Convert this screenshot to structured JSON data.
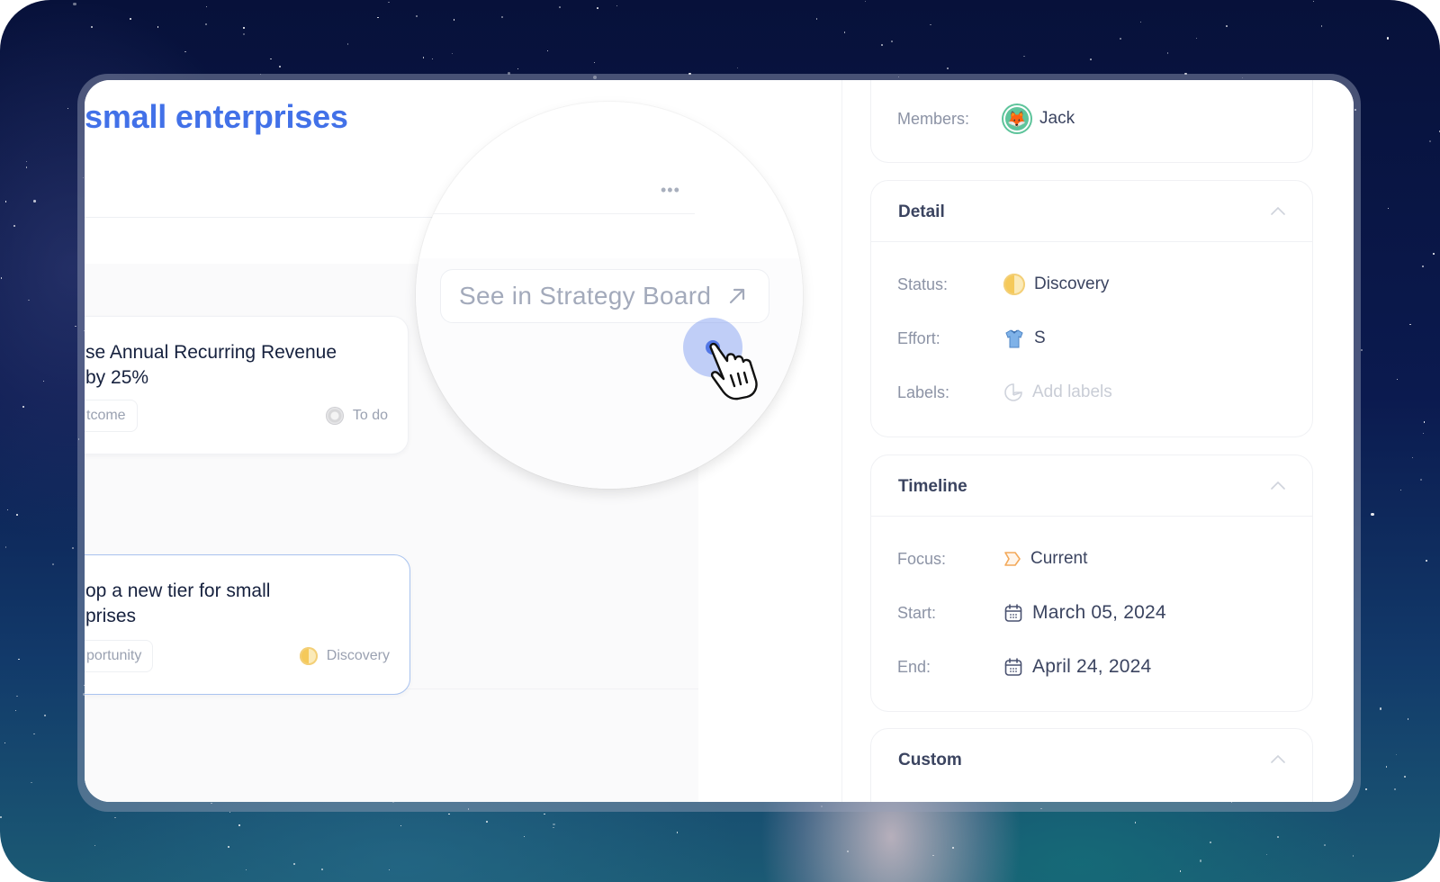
{
  "main": {
    "title": "small enterprises",
    "more_menu_glyph": "•••",
    "strategy_button": {
      "label": "See in Strategy Board",
      "icon": "arrow-up-right-icon"
    },
    "cards": [
      {
        "title_lines": [
          "se Annual Recurring Revenue",
          "by 25%"
        ],
        "tag": "tcome",
        "status": "To do",
        "status_icon": "todo-circle-icon",
        "selected": false
      },
      {
        "title_lines": [
          "op a new tier for small",
          "prises"
        ],
        "tag": "portunity",
        "status": "Discovery",
        "status_icon": "half-moon-icon",
        "selected": true
      }
    ]
  },
  "side_panel": {
    "members": {
      "label": "Members:",
      "value": "Jack",
      "avatar_emoji": "🦊"
    },
    "detail": {
      "title": "Detail",
      "expanded": true,
      "fields": {
        "status": {
          "label": "Status:",
          "value": "Discovery",
          "icon": "half-moon-icon"
        },
        "effort": {
          "label": "Effort:",
          "value": "S",
          "icon": "shirt-icon"
        },
        "labels": {
          "label": "Labels:",
          "value": "Add labels",
          "icon": "label-tag-icon"
        }
      }
    },
    "timeline": {
      "title": "Timeline",
      "expanded": true,
      "fields": {
        "focus": {
          "label": "Focus:",
          "value": "Current",
          "icon": "focus-chevron-icon"
        },
        "start": {
          "label": "Start:",
          "value": "March 05, 2024",
          "icon": "calendar-icon"
        },
        "end": {
          "label": "End:",
          "value": "April 24, 2024",
          "icon": "calendar-icon"
        }
      }
    },
    "custom": {
      "title": "Custom",
      "expanded": true
    }
  },
  "colors": {
    "accent": "#4271e8",
    "selected_card_border": "#a9c3ef",
    "discovery_yellow": "#f5c95a",
    "focus_orange": "#f3a95a",
    "avatar_green": "#5ec49b"
  }
}
